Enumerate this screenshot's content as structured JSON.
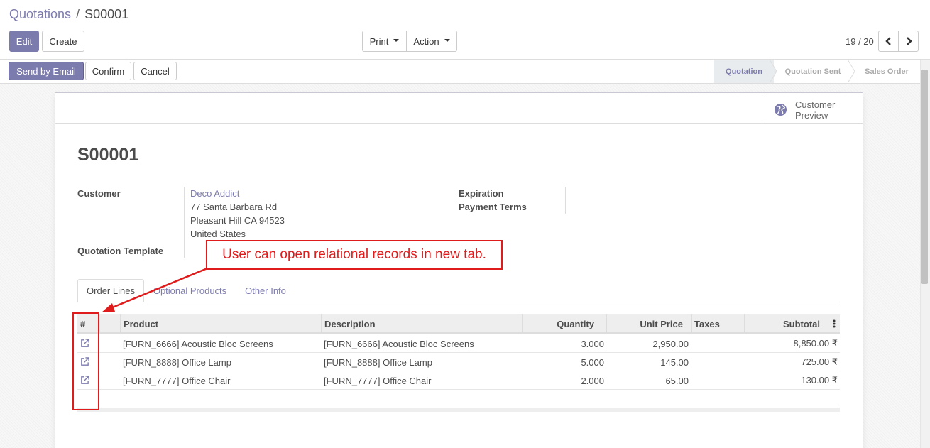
{
  "breadcrumb": {
    "parent": "Quotations",
    "separator": "/",
    "current": "S00001"
  },
  "control_panel": {
    "edit_label": "Edit",
    "create_label": "Create",
    "print_label": "Print",
    "action_label": "Action",
    "pager_value": "19 / 20"
  },
  "statusbar": {
    "send_email_label": "Send by Email",
    "confirm_label": "Confirm",
    "cancel_label": "Cancel",
    "stages": [
      "Quotation",
      "Quotation Sent",
      "Sales Order"
    ],
    "active_stage": "Quotation"
  },
  "smart_button": {
    "line1": "Customer",
    "line2": "Preview",
    "icon": "globe-icon"
  },
  "record": {
    "name": "S00001",
    "customer_label": "Customer",
    "customer_name": "Deco Addict",
    "address_line1": "77 Santa Barbara Rd",
    "address_line2": "Pleasant Hill CA 94523",
    "address_line3": "United States",
    "template_label": "Quotation Template",
    "expiration_label": "Expiration",
    "payment_terms_label": "Payment Terms"
  },
  "tabs": [
    "Order Lines",
    "Optional Products",
    "Other Info"
  ],
  "table": {
    "headers": {
      "index": "#",
      "product": "Product",
      "description": "Description",
      "quantity": "Quantity",
      "unit_price": "Unit Price",
      "taxes": "Taxes",
      "subtotal": "Subtotal"
    },
    "rows": [
      {
        "product": "[FURN_6666] Acoustic Bloc Screens",
        "description": "[FURN_6666] Acoustic Bloc Screens",
        "quantity": "3.000",
        "unit_price": "2,950.00",
        "taxes": "",
        "subtotal": "8,850.00 ₹"
      },
      {
        "product": "[FURN_8888] Office Lamp",
        "description": "[FURN_8888] Office Lamp",
        "quantity": "5.000",
        "unit_price": "145.00",
        "taxes": "",
        "subtotal": "725.00 ₹"
      },
      {
        "product": "[FURN_7777] Office Chair",
        "description": "[FURN_7777] Office Chair",
        "quantity": "2.000",
        "unit_price": "65.00",
        "taxes": "",
        "subtotal": "130.00 ₹"
      }
    ]
  },
  "annotation": {
    "text": "User can open relational records in new tab."
  },
  "colors": {
    "brand": "#7c7bad",
    "annotation": "#e01b1b"
  }
}
